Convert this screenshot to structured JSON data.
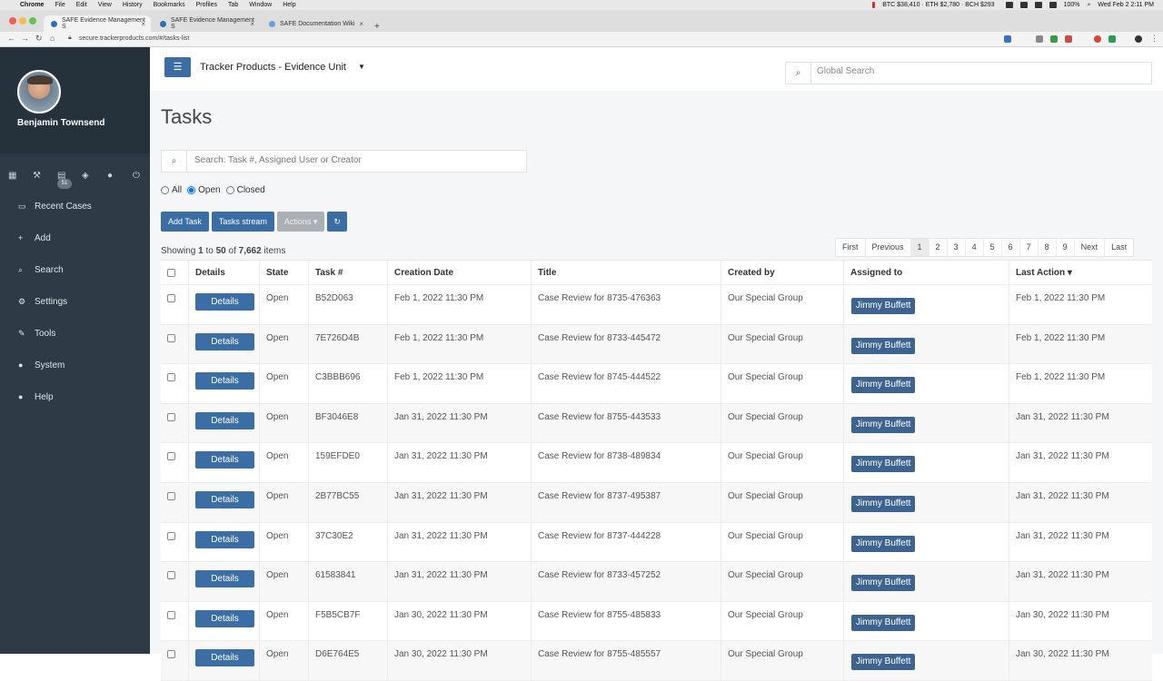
{
  "menubar": {
    "items": [
      "Chrome",
      "File",
      "Edit",
      "View",
      "History",
      "Bookmarks",
      "Profiles",
      "Tab",
      "Window",
      "Help"
    ],
    "crypto": "BTC $38,410 · ETH $2,780 · BCH $293",
    "battery": "100%",
    "clock": "Wed Feb 2  2:11 PM"
  },
  "browser": {
    "tabs": [
      "SAFE Evidence Management S",
      "SAFE Evidence Management S",
      "SAFE Documentation Wiki"
    ],
    "url": "secure.trackerproducts.com/#/tasks-list"
  },
  "sidebar": {
    "user_name": "Benjamin Townsend",
    "badge_count": "51",
    "items": [
      {
        "label": "Recent Cases",
        "icon": "laptop-icon"
      },
      {
        "label": "Add",
        "icon": "plus-icon"
      },
      {
        "label": "Search",
        "icon": "search-icon"
      },
      {
        "label": "Settings",
        "icon": "gears-icon"
      },
      {
        "label": "Tools",
        "icon": "wrench-icon"
      },
      {
        "label": "System",
        "icon": "info-circle-icon"
      },
      {
        "label": "Help",
        "icon": "question-circle-icon"
      }
    ]
  },
  "header": {
    "unit_name": "Tracker Products - Evidence Unit",
    "global_search_placeholder": "Global Search"
  },
  "page": {
    "title": "Tasks",
    "search_placeholder": "Search: Task #, Assigned User or Creator",
    "filters": {
      "all": "All",
      "open": "Open",
      "closed": "Closed",
      "selected": "Open"
    },
    "buttons": {
      "add_task": "Add Task",
      "tasks_stream": "Tasks stream",
      "actions": "Actions ▾"
    },
    "showing": {
      "prefix": "Showing",
      "from": "1",
      "to_word": "to",
      "to": "50",
      "of_word": "of",
      "total": "7,662",
      "suffix": "items"
    },
    "pagination": [
      "First",
      "Previous",
      "1",
      "2",
      "3",
      "4",
      "5",
      "6",
      "7",
      "8",
      "9",
      "Next",
      "Last"
    ],
    "current_page": "1"
  },
  "table": {
    "headers": {
      "details": "Details",
      "state": "State",
      "task": "Task #",
      "created": "Creation Date",
      "title": "Title",
      "created_by": "Created by",
      "assigned": "Assigned to",
      "last_action": "Last Action ▾"
    },
    "details_label": "Details",
    "rows": [
      {
        "state": "Open",
        "task": "B52D063",
        "created": "Feb 1, 2022 11:30 PM",
        "title": "Case Review for 8735-476363",
        "created_by": "Our Special Group",
        "assigned": "Jimmy Buffett",
        "last_action": "Feb 1, 2022 11:30 PM"
      },
      {
        "state": "Open",
        "task": "7E726D4B",
        "created": "Feb 1, 2022 11:30 PM",
        "title": "Case Review for 8733-445472",
        "created_by": "Our Special Group",
        "assigned": "Jimmy Buffett",
        "last_action": "Feb 1, 2022 11:30 PM"
      },
      {
        "state": "Open",
        "task": "C3BBB696",
        "created": "Feb 1, 2022 11:30 PM",
        "title": "Case Review for 8745-444522",
        "created_by": "Our Special Group",
        "assigned": "Jimmy Buffett",
        "last_action": "Feb 1, 2022 11:30 PM"
      },
      {
        "state": "Open",
        "task": "BF3046E8",
        "created": "Jan 31, 2022 11:30 PM",
        "title": "Case Review for 8755-443533",
        "created_by": "Our Special Group",
        "assigned": "Jimmy Buffett",
        "last_action": "Jan 31, 2022 11:30 PM"
      },
      {
        "state": "Open",
        "task": "159EFDE0",
        "created": "Jan 31, 2022 11:30 PM",
        "title": "Case Review for 8738-489834",
        "created_by": "Our Special Group",
        "assigned": "Jimmy Buffett",
        "last_action": "Jan 31, 2022 11:30 PM"
      },
      {
        "state": "Open",
        "task": "2B77BC55",
        "created": "Jan 31, 2022 11:30 PM",
        "title": "Case Review for 8737-495387",
        "created_by": "Our Special Group",
        "assigned": "Jimmy Buffett",
        "last_action": "Jan 31, 2022 11:30 PM"
      },
      {
        "state": "Open",
        "task": "37C30E2",
        "created": "Jan 31, 2022 11:30 PM",
        "title": "Case Review for 8737-444228",
        "created_by": "Our Special Group",
        "assigned": "Jimmy Buffett",
        "last_action": "Jan 31, 2022 11:30 PM"
      },
      {
        "state": "Open",
        "task": "61583841",
        "created": "Jan 31, 2022 11:30 PM",
        "title": "Case Review for 8733-457252",
        "created_by": "Our Special Group",
        "assigned": "Jimmy Buffett",
        "last_action": "Jan 31, 2022 11:30 PM"
      },
      {
        "state": "Open",
        "task": "F5B5CB7F",
        "created": "Jan 30, 2022 11:30 PM",
        "title": "Case Review for 8755-485833",
        "created_by": "Our Special Group",
        "assigned": "Jimmy Buffett",
        "last_action": "Jan 30, 2022 11:30 PM"
      },
      {
        "state": "Open",
        "task": "D6E764E5",
        "created": "Jan 30, 2022 11:30 PM",
        "title": "Case Review for 8755-485557",
        "created_by": "Our Special Group",
        "assigned": "Jimmy Buffett",
        "last_action": "Jan 30, 2022 11:30 PM"
      }
    ]
  },
  "colors": {
    "sidebar": "#2e3b46",
    "primary": "#3a6ea5",
    "assignee_badge": "#3d6490"
  }
}
